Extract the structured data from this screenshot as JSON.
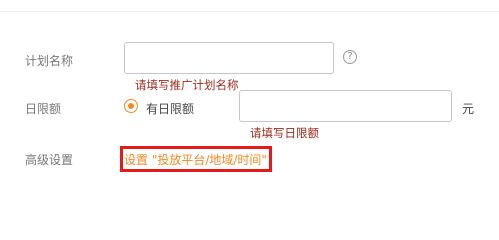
{
  "form": {
    "plan_name": {
      "label": "计划名称",
      "value": "",
      "error": "请填写推广计划名称",
      "help_icon": "question-circle-icon"
    },
    "daily_limit": {
      "label": "日限额",
      "radio_label": "有日限额",
      "radio_selected": true,
      "value": "",
      "unit": "元",
      "error": "请填写日限额"
    },
    "advanced": {
      "label": "高级设置",
      "link_text": "设置 \"投放平台/地域/时间\""
    }
  },
  "colors": {
    "accent": "#f08a24",
    "error": "#9b2a1b",
    "highlight": "#e31b1b"
  }
}
